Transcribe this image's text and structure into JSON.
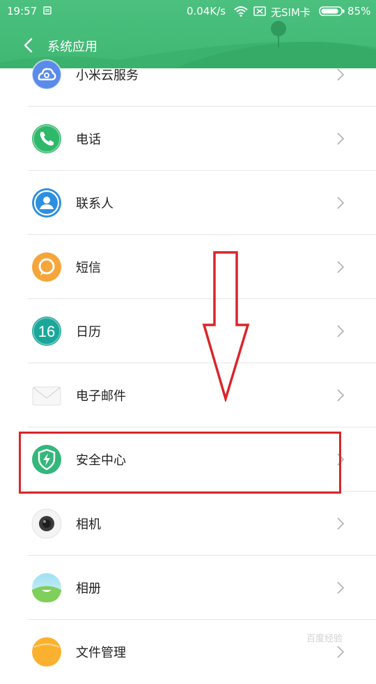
{
  "status_bar": {
    "time": "19:57",
    "network_speed": "0.04K/s",
    "sim_status": "无SIM卡",
    "battery": "85%"
  },
  "header": {
    "title": "系统应用"
  },
  "items": [
    {
      "label": "小米云服务",
      "icon": "cloud-icon"
    },
    {
      "label": "电话",
      "icon": "phone-icon"
    },
    {
      "label": "联系人",
      "icon": "contacts-icon"
    },
    {
      "label": "短信",
      "icon": "sms-icon"
    },
    {
      "label": "日历",
      "icon": "calendar-icon",
      "icon_text": "16"
    },
    {
      "label": "电子邮件",
      "icon": "mail-icon"
    },
    {
      "label": "安全中心",
      "icon": "security-shield-icon"
    },
    {
      "label": "相机",
      "icon": "camera-icon"
    },
    {
      "label": "相册",
      "icon": "gallery-icon"
    },
    {
      "label": "文件管理",
      "icon": "file-manager-icon"
    }
  ],
  "annotation": {
    "highlighted_item": "安全中心",
    "color": "#d9262a"
  },
  "watermark": "百度经验",
  "colors": {
    "header_green": "#45bc78",
    "divider": "#e6e6e6"
  }
}
